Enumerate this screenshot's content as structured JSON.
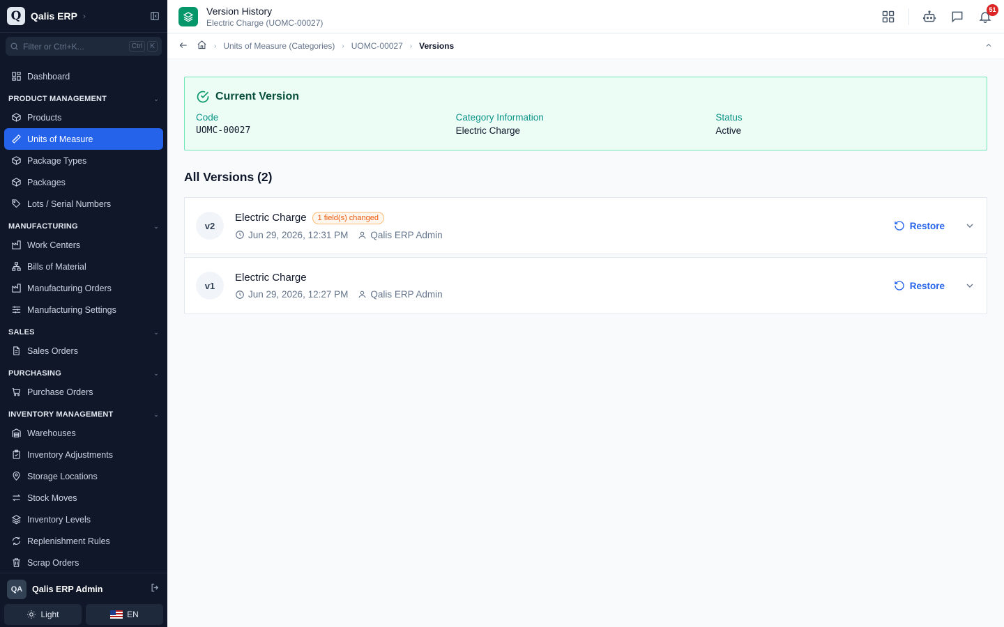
{
  "app": {
    "name": "Qalis ERP",
    "logo_letter": "Q"
  },
  "sidebar": {
    "filter_placeholder": "Filter or Ctrl+K...",
    "kbd_ctrl": "Ctrl",
    "kbd_k": "K",
    "dashboard": "Dashboard",
    "sections": {
      "product": "PRODUCT MANAGEMENT",
      "manufacturing": "MANUFACTURING",
      "sales": "SALES",
      "purchasing": "PURCHASING",
      "inventory": "INVENTORY MANAGEMENT"
    },
    "items": {
      "products": "Products",
      "uom": "Units of Measure",
      "package_types": "Package Types",
      "packages": "Packages",
      "lots": "Lots / Serial Numbers",
      "work_centers": "Work Centers",
      "bom": "Bills of Material",
      "mo": "Manufacturing Orders",
      "mfg_settings": "Manufacturing Settings",
      "sales_orders": "Sales Orders",
      "purchase_orders": "Purchase Orders",
      "warehouses": "Warehouses",
      "inv_adjustments": "Inventory Adjustments",
      "storage_locations": "Storage Locations",
      "stock_moves": "Stock Moves",
      "inv_levels": "Inventory Levels",
      "replenishment": "Replenishment Rules",
      "scrap": "Scrap Orders"
    },
    "user": {
      "initials": "QA",
      "name": "Qalis ERP Admin"
    },
    "theme_label": "Light",
    "lang_label": "EN"
  },
  "header": {
    "title": "Version History",
    "subtitle": "Electric Charge (UOMC-00027)",
    "notification_count": "51"
  },
  "breadcrumb": {
    "items": [
      "Units of Measure (Categories)",
      "UOMC-00027"
    ],
    "current": "Versions"
  },
  "current_version": {
    "title": "Current Version",
    "fields": [
      {
        "label": "Code",
        "value": "UOMC-00027"
      },
      {
        "label": "Category Information",
        "value": "Electric Charge"
      },
      {
        "label": "Status",
        "value": "Active"
      }
    ]
  },
  "versions": {
    "title": "All Versions (2)",
    "restore_label": "Restore",
    "list": [
      {
        "tag": "v2",
        "name": "Electric Charge",
        "badge": "1 field(s) changed",
        "date": "Jun 29, 2026, 12:31 PM",
        "user": "Qalis ERP Admin"
      },
      {
        "tag": "v1",
        "name": "Electric Charge",
        "date": "Jun 29, 2026, 12:27 PM",
        "user": "Qalis ERP Admin"
      }
    ]
  },
  "colors": {
    "accent": "#2563eb",
    "success": "#059669",
    "warning": "#ea580c",
    "sidebar_bg": "#0f1729"
  }
}
